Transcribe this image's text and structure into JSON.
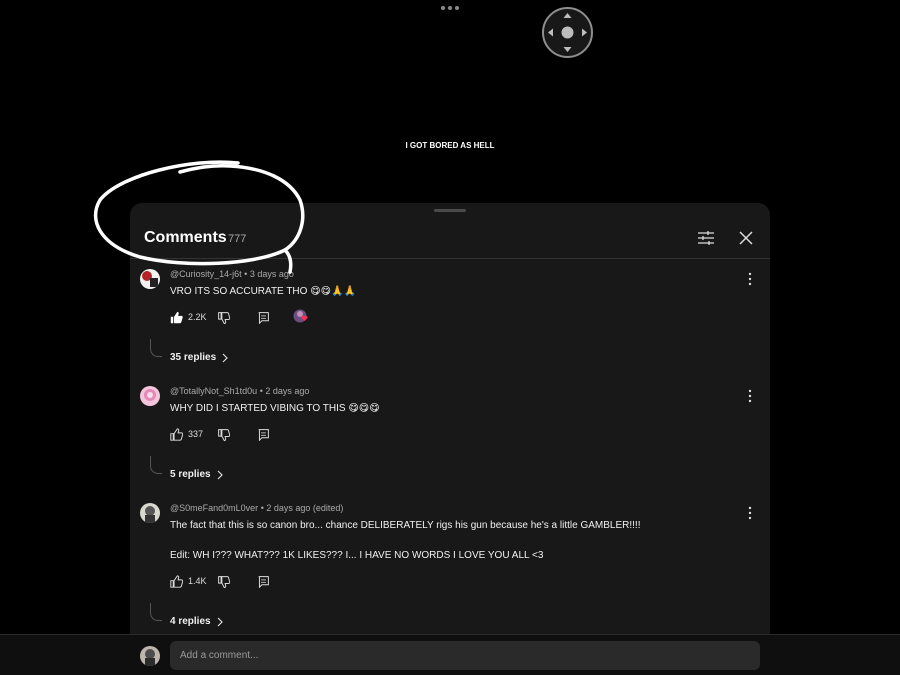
{
  "video": {
    "caption": "I GOT BORED AS HELL"
  },
  "panel": {
    "title": "Comments",
    "count": "777",
    "icons": [
      "filter-icon",
      "close-icon"
    ]
  },
  "comments": [
    {
      "author": "@Curiosity_14-j6t",
      "time": "3 days ago",
      "text": "VRO ITS SO ACCURATE THO 😋😋🙏🙏",
      "likes": "2.2K",
      "liked": true,
      "creator_hearted": true,
      "replies": "35 replies",
      "avatar_color": "#b3242a"
    },
    {
      "author": "@TotallyNot_Sh1td0u",
      "time": "2 days ago",
      "text": "WHY DID I STARTED VIBING TO THIS 😋😋😋",
      "likes": "337",
      "liked": false,
      "creator_hearted": false,
      "replies": "5 replies",
      "avatar_color": "#e7a3c8"
    },
    {
      "author": "@S0meFand0mL0ver",
      "time": "2 days ago (edited)",
      "text": "The fact that this is so canon bro... chance DELIBERATELY rigs his gun because he's a little GAMBLER!!!!",
      "text2": "Edit: WH I??? WHAT??? 1K LIKES??? I... I HAVE NO WORDS I LOVE YOU ALL <3",
      "likes": "1.4K",
      "liked": false,
      "creator_hearted": false,
      "replies": "4 replies",
      "avatar_color": "#6b6b5e"
    }
  ],
  "composer": {
    "placeholder": "Add a comment..."
  },
  "colors": {
    "background": "#000000",
    "panel": "#181818",
    "heart": "#ff2d55",
    "scribble": "#ffffff"
  }
}
